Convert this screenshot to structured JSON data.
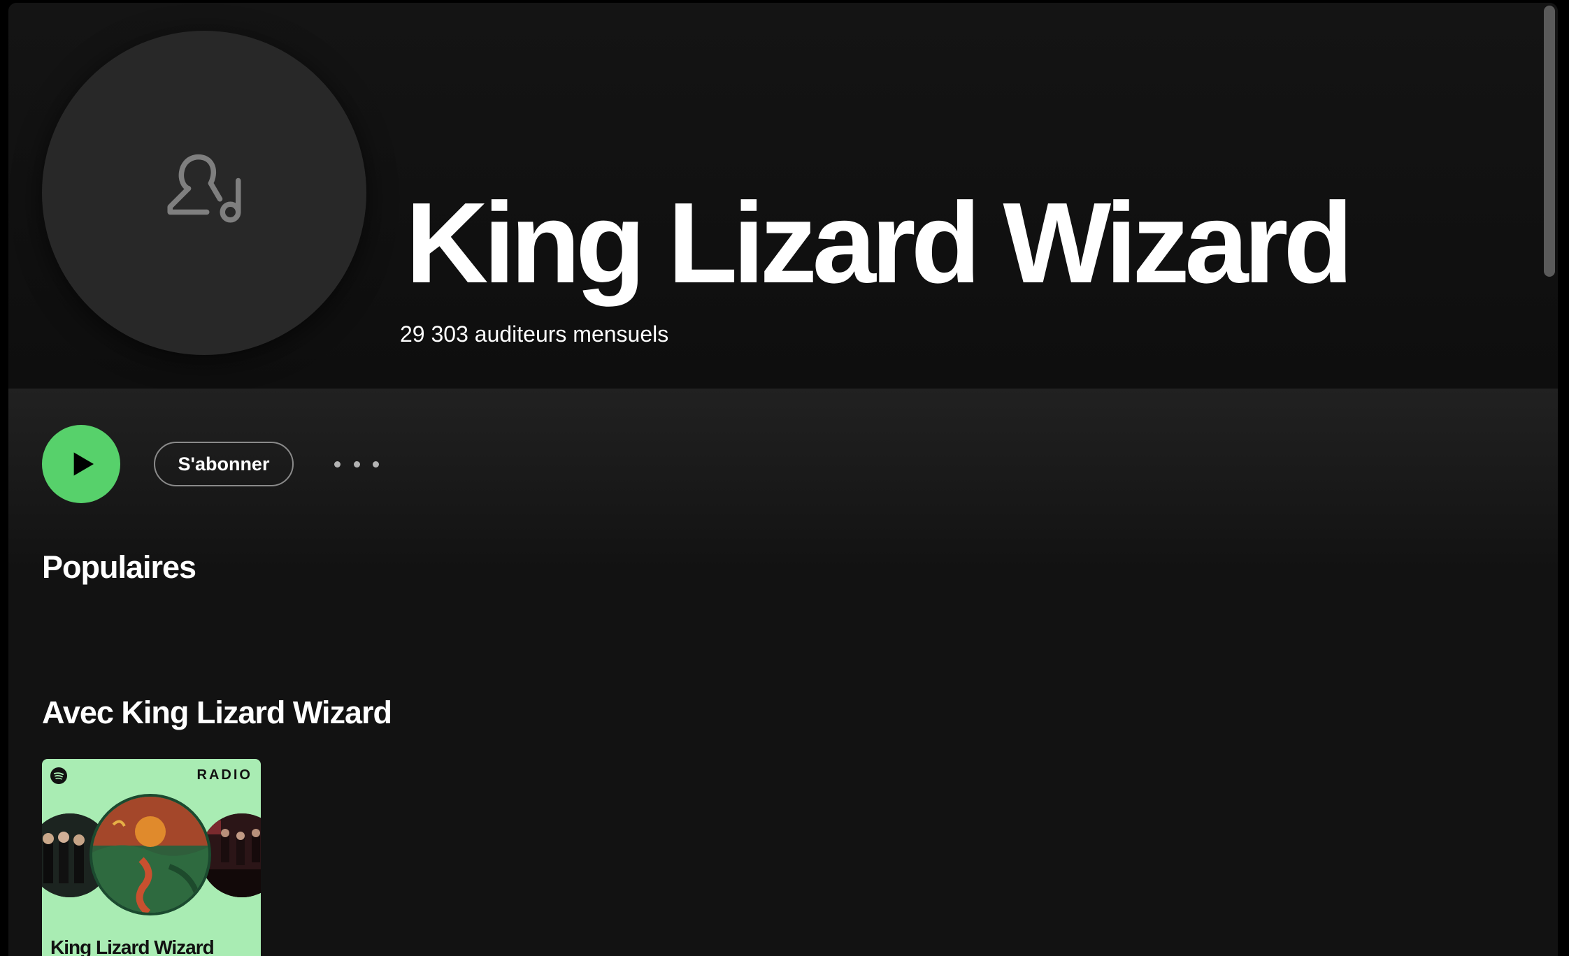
{
  "artist": {
    "name": "King Lizard Wizard",
    "monthly_listeners": "29 303 auditeurs mensuels",
    "avatar_icon": "artist-placeholder-icon"
  },
  "actions": {
    "play_icon": "play-icon",
    "follow_label": "S'abonner",
    "more_icon": "more-options-icon"
  },
  "sections": {
    "popular_title": "Populaires",
    "featuring_title": "Avec King Lizard Wizard"
  },
  "radio_card": {
    "badge": "RADIO",
    "title": "King Lizard Wizard",
    "background_color": "#a9ecb3"
  },
  "colors": {
    "accent": "#1ed760",
    "background": "#121212"
  }
}
